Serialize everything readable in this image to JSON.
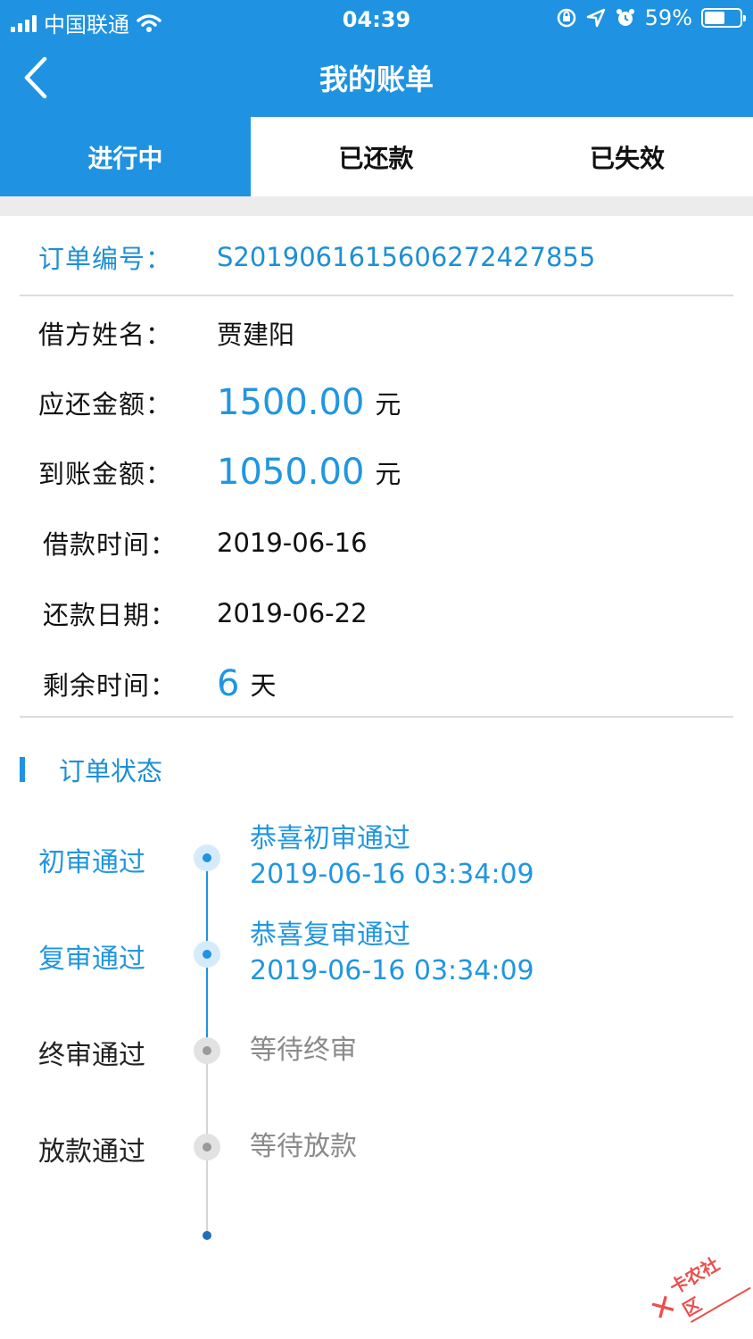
{
  "status_bar": {
    "carrier": "中国联通",
    "time": "04:39",
    "battery_pct": "59%",
    "battery_level": 0.59
  },
  "nav": {
    "title": "我的账单",
    "back_icon": "chevron-left-icon"
  },
  "tabs": [
    {
      "label": "进行中",
      "active": true
    },
    {
      "label": "已还款",
      "active": false
    },
    {
      "label": "已失效",
      "active": false
    }
  ],
  "order": {
    "label": "订单编号：",
    "number": "S2019061615606272427855"
  },
  "details": {
    "borrower_label": "借方姓名：",
    "borrower_value": "贾建阳",
    "due_label": "应还金额：",
    "due_value": "1500.00",
    "due_unit": "元",
    "received_label": "到账金额：",
    "received_value": "1050.00",
    "received_unit": "元",
    "loan_date_label": "借款时间：",
    "loan_date_value": "2019-06-16",
    "repay_date_label": "还款日期：",
    "repay_date_value": "2019-06-22",
    "remaining_label": "剩余时间：",
    "remaining_value": "6",
    "remaining_unit": "天"
  },
  "status_section": {
    "title": "订单状态"
  },
  "timeline": [
    {
      "label": "初审通过",
      "line1": "恭喜初审通过",
      "line2": "2019-06-16 03:34:09",
      "done": true
    },
    {
      "label": "复审通过",
      "line1": "恭喜复审通过",
      "line2": "2019-06-16 03:34:09",
      "done": true
    },
    {
      "label": "终审通过",
      "line1": "等待终审",
      "line2": "",
      "done": false
    },
    {
      "label": "放款通过",
      "line1": "等待放款",
      "line2": "",
      "done": false
    }
  ],
  "watermark": {
    "text": "卡农社区"
  },
  "colors": {
    "primary": "#1f93e2",
    "accent_text": "#2196e0",
    "done_dot": "#d6ebfa",
    "done_inner": "#1f93e2",
    "pending_dot": "#e2e2e2",
    "pending_inner": "#9a9a9a",
    "pending_text": "#8a8a8a"
  }
}
